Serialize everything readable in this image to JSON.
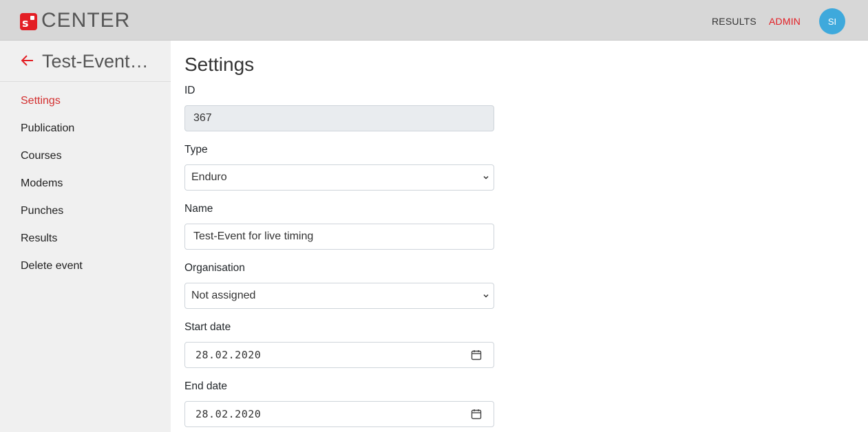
{
  "header": {
    "logo_mark": "s",
    "logo_text": "CENTER",
    "nav": {
      "results": "RESULTS",
      "admin": "ADMIN"
    },
    "avatar_initials": "SI",
    "colors": {
      "brand_red": "#e31e24",
      "avatar_blue": "#3ea9dc",
      "bar_gray": "#d7d7d7"
    }
  },
  "sidebar": {
    "back_icon": "arrow-left-icon",
    "event_title": "Test-Event for live timing",
    "items": [
      {
        "label": "Settings",
        "active": true
      },
      {
        "label": "Publication"
      },
      {
        "label": "Courses"
      },
      {
        "label": "Modems"
      },
      {
        "label": "Punches"
      },
      {
        "label": "Results"
      },
      {
        "label": "Delete event"
      }
    ]
  },
  "main": {
    "title": "Settings",
    "fields": {
      "id": {
        "label": "ID",
        "value": "367"
      },
      "type": {
        "label": "Type",
        "value": "Enduro"
      },
      "name": {
        "label": "Name",
        "value": "Test-Event for live timing"
      },
      "organisation": {
        "label": "Organisation",
        "value": "Not assigned"
      },
      "start_date": {
        "label": "Start date",
        "value": "28.02.2020"
      },
      "end_date": {
        "label": "End date",
        "value": "28.02.2020"
      }
    }
  }
}
